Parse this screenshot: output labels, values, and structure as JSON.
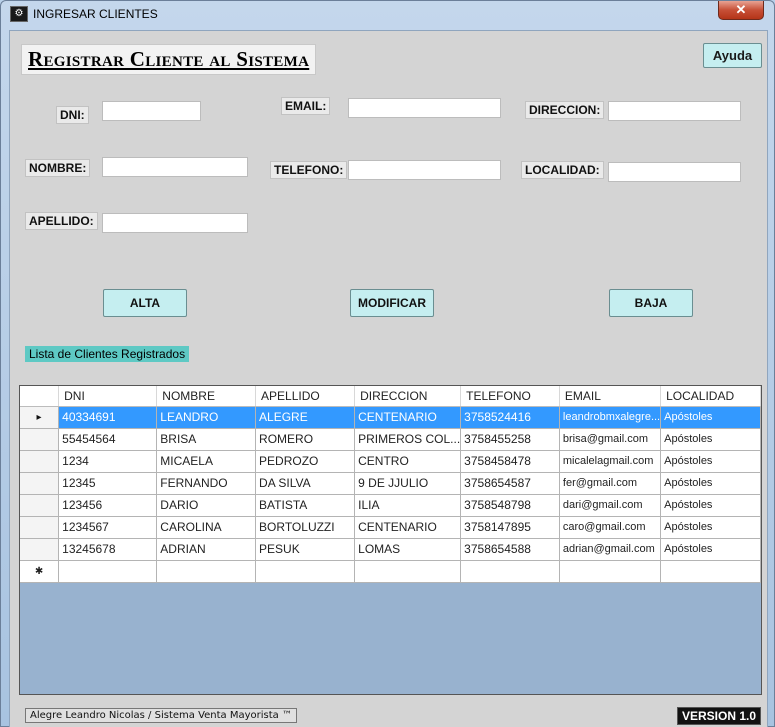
{
  "window": {
    "title": "INGRESAR CLIENTES",
    "close_glyph": "✕"
  },
  "heading": "Registrar Cliente al Sistema",
  "help_label": "Ayuda",
  "form": {
    "dni_label": "DNI:",
    "nombre_label": "NOMBRE:",
    "apellido_label": "APELLIDO:",
    "email_label": "EMAIL:",
    "telefono_label": "TELEFONO:",
    "direccion_label": "DIRECCION:",
    "localidad_label": "LOCALIDAD:"
  },
  "buttons": {
    "alta": "ALTA",
    "modificar": "MODIFICAR",
    "baja": "BAJA"
  },
  "list_label": "Lista de Clientes Registrados",
  "table": {
    "columns": [
      "DNI",
      "NOMBRE",
      "APELLIDO",
      "DIRECCION",
      "TELEFONO",
      "EMAIL",
      "LOCALIDAD"
    ],
    "rows": [
      [
        "40334691",
        "LEANDRO",
        "ALEGRE",
        "CENTENARIO",
        "3758524416",
        "leandrobmxalegre...",
        "Apóstoles"
      ],
      [
        "55454564",
        "BRISA",
        "ROMERO",
        "PRIMEROS COL...",
        "3758455258",
        "brisa@gmail.com",
        "Apóstoles"
      ],
      [
        "1234",
        "MICAELA",
        "PEDROZO",
        "CENTRO",
        "3758458478",
        "micalelagmail.com",
        "Apóstoles"
      ],
      [
        "12345",
        "FERNANDO",
        "DA SILVA",
        "9 DE JJULIO",
        "3758654587",
        "fer@gmail.com",
        "Apóstoles"
      ],
      [
        "123456",
        "DARIO",
        "BATISTA",
        "ILIA",
        "3758548798",
        "dari@gmail.com",
        "Apóstoles"
      ],
      [
        "1234567",
        "CAROLINA",
        "BORTOLUZZI",
        "CENTENARIO",
        "3758147895",
        "caro@gmail.com",
        "Apóstoles"
      ],
      [
        "13245678",
        "ADRIAN",
        "PESUK",
        "LOMAS",
        "3758654588",
        "adrian@gmail.com",
        "Apóstoles"
      ]
    ],
    "row_indicator": "▸",
    "new_row_glyph": "✱"
  },
  "footer": {
    "credit": "Alegre Leandro Nicolas / Sistema Venta Mayorista ™",
    "version": "VERSION 1.0"
  }
}
